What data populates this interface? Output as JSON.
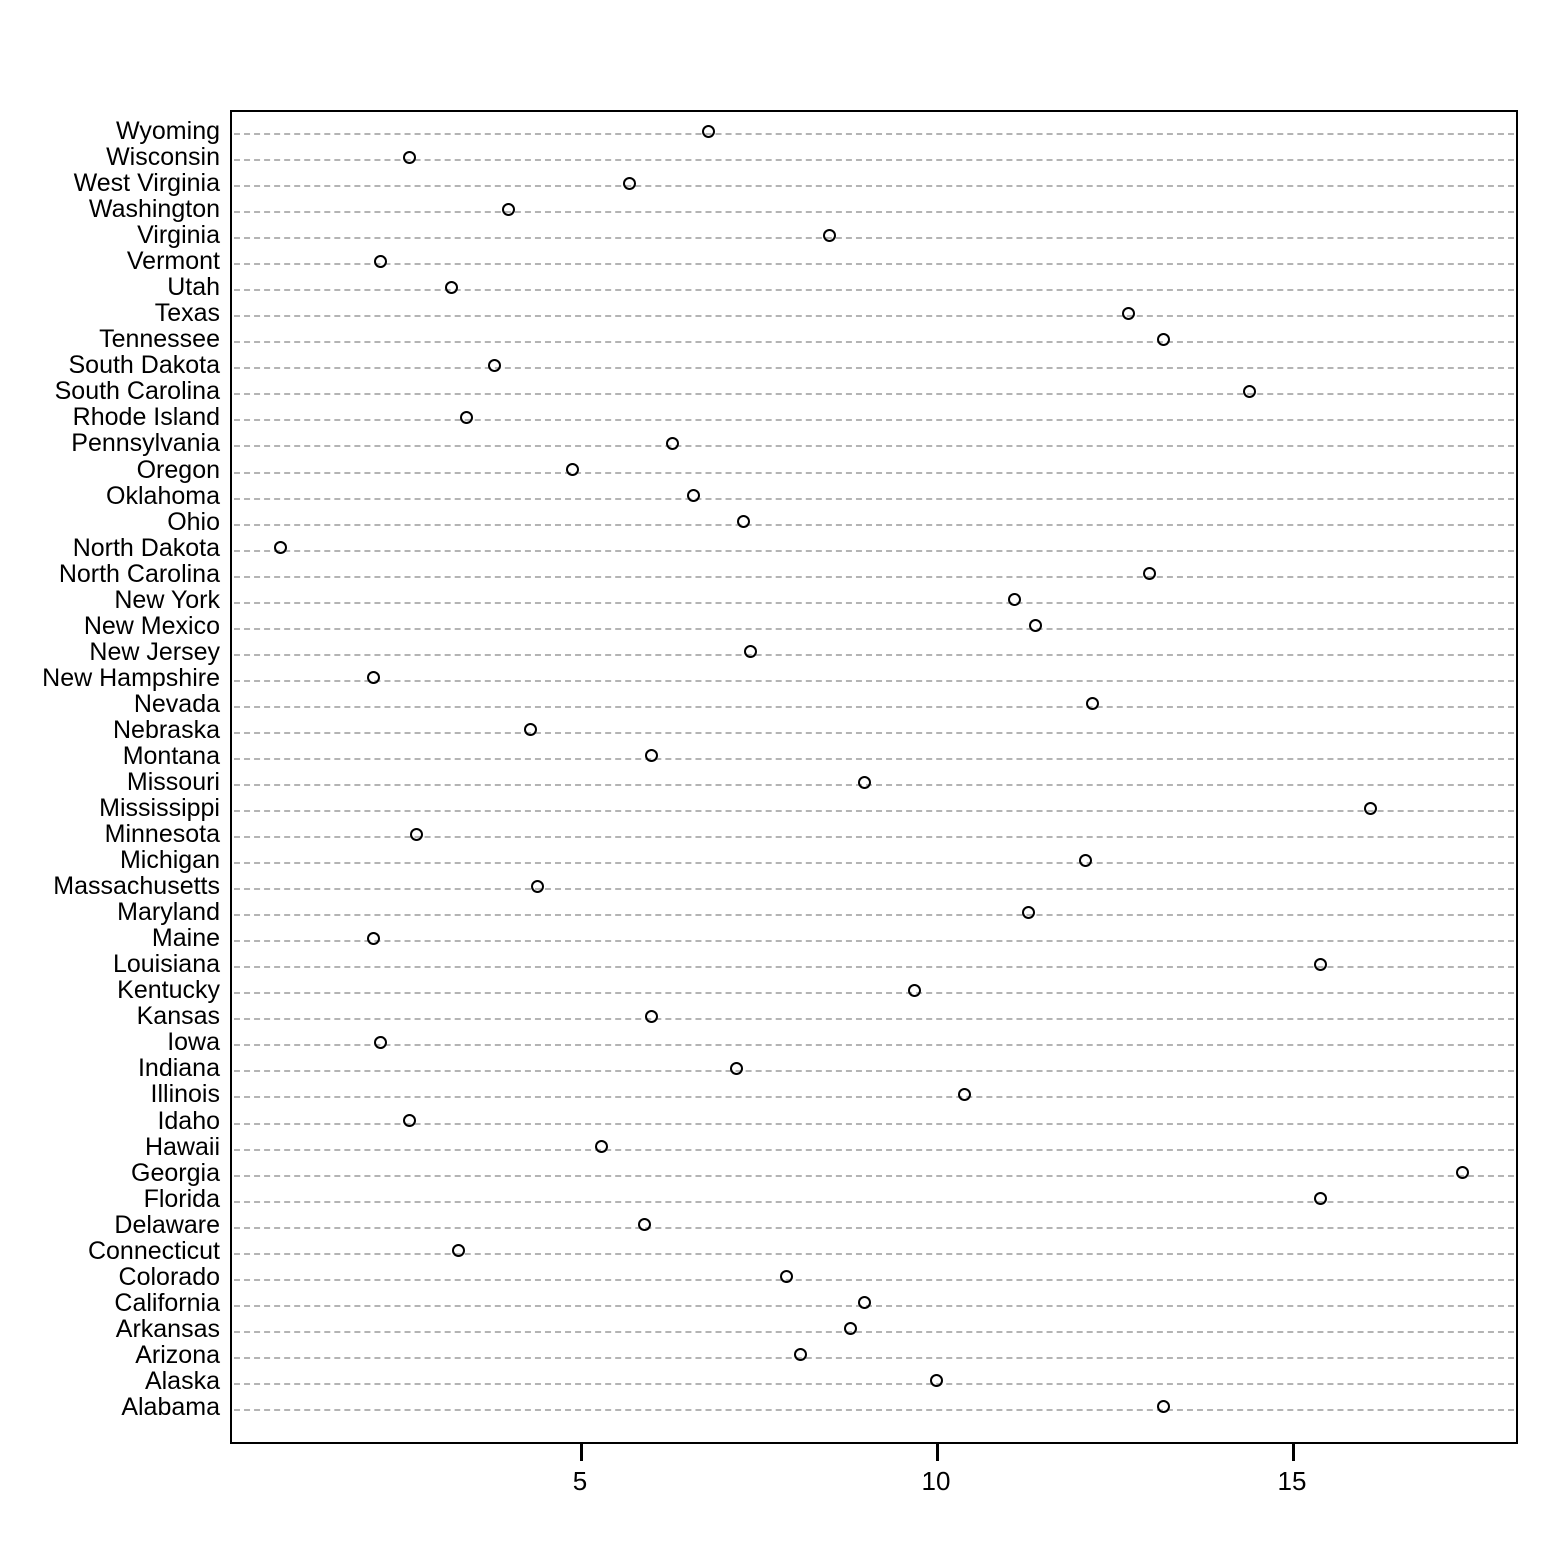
{
  "chart_data": {
    "type": "scatter",
    "title": "",
    "subtitle": "",
    "xlabel": "",
    "ylabel": "",
    "grid": true,
    "legend": null,
    "xlim": [
      0.5,
      17.9
    ],
    "xticks": [
      5,
      10,
      15
    ],
    "xtick_labels": [
      "5",
      "10",
      "15"
    ],
    "marker": "open-circle",
    "marker_color": "#000000",
    "gridline_style": "dashed",
    "gridline_color": "#b4b4b4",
    "orientation": "horizontal",
    "categories": [
      "Wyoming",
      "Wisconsin",
      "West Virginia",
      "Washington",
      "Virginia",
      "Vermont",
      "Utah",
      "Texas",
      "Tennessee",
      "South Dakota",
      "South Carolina",
      "Rhode Island",
      "Pennsylvania",
      "Oregon",
      "Oklahoma",
      "Ohio",
      "North Dakota",
      "North Carolina",
      "New York",
      "New Mexico",
      "New Jersey",
      "New Hampshire",
      "Nevada",
      "Nebraska",
      "Montana",
      "Missouri",
      "Mississippi",
      "Minnesota",
      "Michigan",
      "Massachusetts",
      "Maryland",
      "Maine",
      "Louisiana",
      "Kentucky",
      "Kansas",
      "Iowa",
      "Indiana",
      "Illinois",
      "Idaho",
      "Hawaii",
      "Georgia",
      "Florida",
      "Delaware",
      "Connecticut",
      "Colorado",
      "California",
      "Arkansas",
      "Arizona",
      "Alaska",
      "Alabama"
    ],
    "values": [
      6.8,
      2.6,
      5.7,
      4.0,
      8.5,
      2.2,
      3.2,
      12.7,
      13.2,
      3.8,
      14.4,
      3.4,
      6.3,
      4.9,
      6.6,
      7.3,
      0.8,
      13.0,
      11.1,
      11.4,
      7.4,
      2.1,
      12.2,
      4.3,
      6.0,
      9.0,
      16.1,
      2.7,
      12.1,
      4.4,
      11.3,
      2.1,
      15.4,
      9.7,
      6.0,
      2.2,
      7.2,
      10.4,
      2.6,
      5.3,
      17.4,
      15.4,
      5.9,
      3.3,
      7.9,
      9.0,
      8.8,
      8.1,
      10.0,
      13.2
    ]
  }
}
